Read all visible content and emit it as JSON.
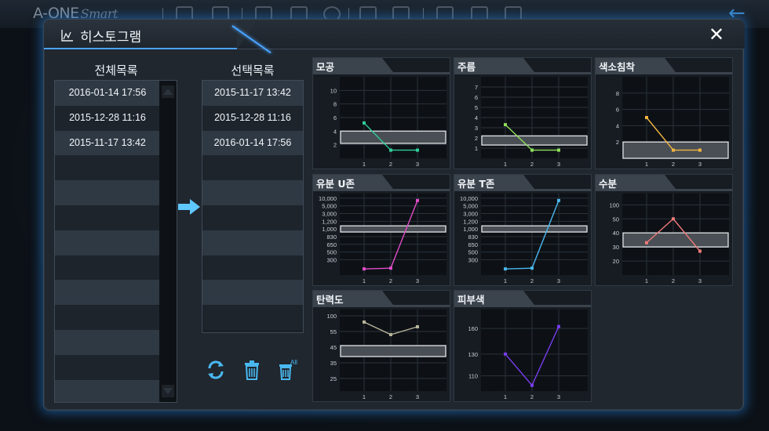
{
  "app": {
    "brand": "A-ONE",
    "brand_suffix": "Smart"
  },
  "dialog": {
    "title": "히스토그램",
    "close_label": "✕"
  },
  "full_list": {
    "heading": "전체목록",
    "items": [
      "2016-01-14 17:56",
      "2015-12-28 11:16",
      "2015-11-17 13:42",
      "",
      "",
      "",
      "",
      "",
      "",
      "",
      "",
      "",
      ""
    ]
  },
  "selected_list": {
    "heading": "선택목록",
    "items": [
      "2015-11-17 13:42",
      "2015-12-28 11:16",
      "2016-01-14 17:56",
      "",
      "",
      "",
      "",
      "",
      "",
      ""
    ]
  },
  "actions": {
    "all_label": "All"
  },
  "colors": {
    "accent": "#4aa3ff",
    "arrow": "#5fc8ff"
  },
  "chart_data": [
    {
      "type": "line",
      "title": "모공",
      "color": "#2fcf9a",
      "x": [
        1,
        2,
        3
      ],
      "values": [
        5.2,
        1.2,
        1.2
      ],
      "yticks": [
        "10",
        "8",
        "6",
        "4",
        "2"
      ],
      "ytick_vals": [
        10,
        8,
        6,
        4,
        2
      ],
      "ylim": [
        0,
        12
      ],
      "band": [
        2.2,
        4
      ]
    },
    {
      "type": "line",
      "title": "주름",
      "color": "#8fe05a",
      "x": [
        1,
        2,
        3
      ],
      "values": [
        3.3,
        0.8,
        0.8
      ],
      "yticks": [
        "7",
        "6",
        "5",
        "4",
        "3",
        "2",
        "1"
      ],
      "ytick_vals": [
        7,
        6,
        5,
        4,
        3,
        2,
        1
      ],
      "ylim": [
        0,
        8
      ],
      "band": [
        1.3,
        2.2
      ]
    },
    {
      "type": "line",
      "title": "색소침착",
      "color": "#f2b440",
      "x": [
        1,
        2,
        3
      ],
      "values": [
        5,
        1,
        1
      ],
      "yticks": [
        "8",
        "6",
        "4",
        "2"
      ],
      "ytick_vals": [
        8,
        6,
        4,
        2
      ],
      "ylim": [
        0,
        10
      ],
      "band": [
        0,
        2
      ]
    },
    {
      "type": "line",
      "title": "유분 U존",
      "color": "#e04cc8",
      "x": [
        1,
        2,
        3
      ],
      "values": [
        0.8,
        0.9,
        9.7
      ],
      "yticks": [
        "10,000",
        "5,000",
        "3,000",
        "1,200",
        "1,000",
        "830",
        "650",
        "500",
        "300"
      ],
      "ytick_vals": [
        10,
        9,
        8,
        7,
        6,
        5,
        4,
        3,
        2
      ],
      "ylim": [
        0,
        10.6
      ],
      "band": [
        5.6,
        6.4
      ]
    },
    {
      "type": "line",
      "title": "유분 T존",
      "color": "#4ab8f0",
      "x": [
        1,
        2,
        3
      ],
      "values": [
        0.8,
        0.9,
        9.7
      ],
      "yticks": [
        "10,000",
        "5,000",
        "3,000",
        "1,200",
        "1,000",
        "830",
        "650",
        "500",
        "300"
      ],
      "ytick_vals": [
        10,
        9,
        8,
        7,
        6,
        5,
        4,
        3,
        2
      ],
      "ylim": [
        0,
        10.6
      ],
      "band": [
        5.6,
        6.4
      ]
    },
    {
      "type": "line",
      "title": "수분",
      "color": "#f07a7a",
      "x": [
        1,
        2,
        3
      ],
      "values": [
        33,
        50,
        27
      ],
      "yticks": [
        "100",
        "50",
        "40",
        "30",
        "20"
      ],
      "ytick_vals": [
        60,
        50,
        40,
        30,
        20
      ],
      "ylim": [
        10,
        68
      ],
      "band": [
        30,
        40
      ]
    },
    {
      "type": "line",
      "title": "탄력도",
      "color": "#b8b49a",
      "x": [
        1,
        2,
        3
      ],
      "values": [
        94,
        86,
        91
      ],
      "yticks": [
        "100",
        "55",
        "45",
        "35",
        "25"
      ],
      "ytick_vals": [
        98,
        88,
        78,
        68,
        58
      ],
      "ylim": [
        50,
        102
      ],
      "band": [
        72,
        79
      ]
    },
    {
      "type": "line",
      "title": "피부색",
      "color": "#7a3cf0",
      "x": [
        1,
        2,
        3
      ],
      "values": [
        133,
        100,
        162
      ],
      "yticks": [
        "160",
        "130",
        "110"
      ],
      "ytick_vals": [
        160,
        133,
        110
      ],
      "ylim": [
        94,
        180
      ],
      "band": null
    }
  ]
}
